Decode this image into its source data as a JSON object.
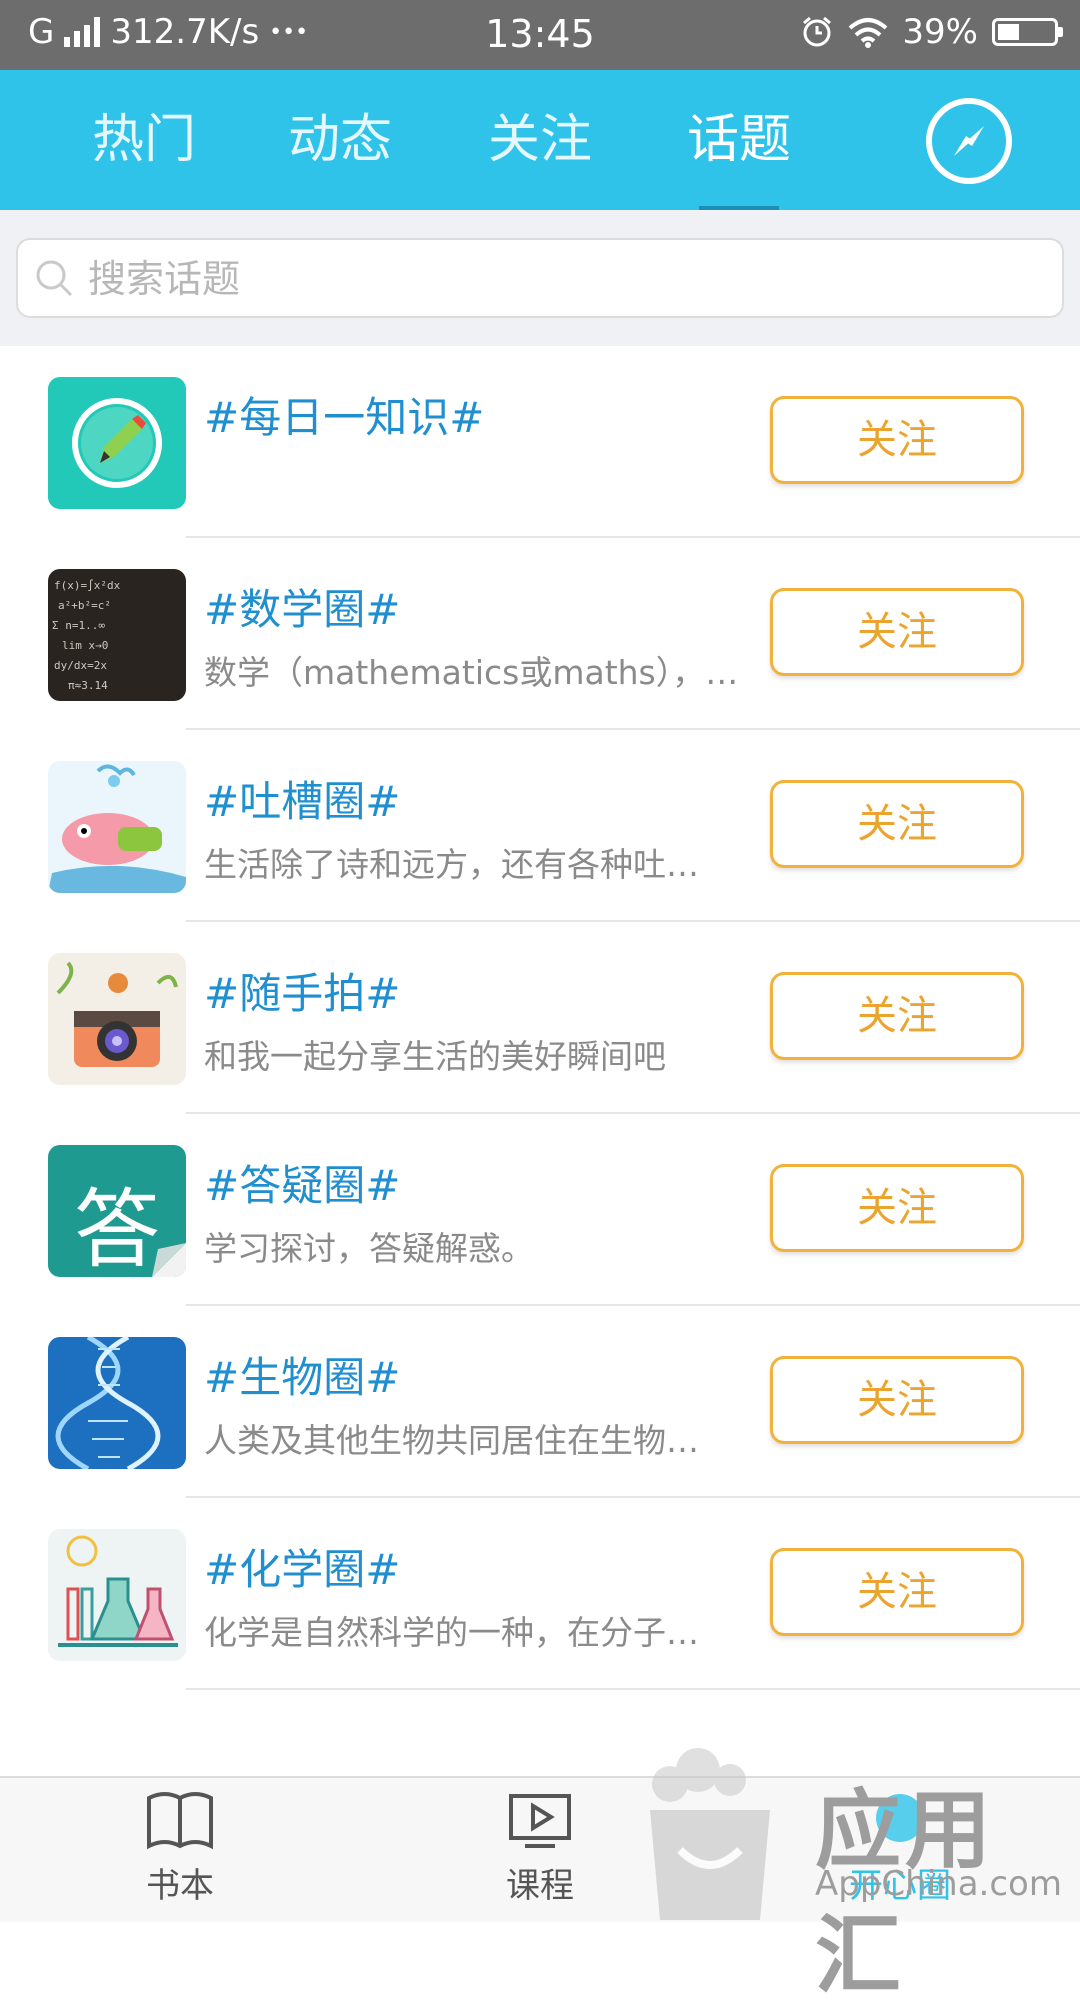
{
  "status_bar": {
    "carrier": "G",
    "speed": "312.7K/s",
    "dots": "•••",
    "time": "13:45",
    "battery_text": "39%",
    "battery_level": 0.39
  },
  "header": {
    "tabs": [
      {
        "label": "热门",
        "active": false
      },
      {
        "label": "动态",
        "active": false
      },
      {
        "label": "关注",
        "active": false
      },
      {
        "label": "话题",
        "active": true
      }
    ],
    "compass_icon": "compass-icon",
    "background": "#2fc3ea"
  },
  "search": {
    "placeholder": "搜索话题",
    "value": ""
  },
  "topics": [
    {
      "title": "#每日一知识#",
      "desc": "",
      "follow": "关注",
      "icon": "pencil-circle-icon"
    },
    {
      "title": "#数学圈#",
      "desc": "数学（mathematics或maths），…",
      "follow": "关注",
      "icon": "chalkboard-icon"
    },
    {
      "title": "#吐槽圈#",
      "desc": "生活除了诗和远方，还有各种吐…",
      "follow": "关注",
      "icon": "patrick-star-icon"
    },
    {
      "title": "#随手拍#",
      "desc": "和我一起分享生活的美好瞬间吧",
      "follow": "关注",
      "icon": "camera-icon"
    },
    {
      "title": "#答疑圈#",
      "desc": "学习探讨，答疑解惑。",
      "follow": "关注",
      "icon": "answer-icon"
    },
    {
      "title": "#生物圈#",
      "desc": "人类及其他生物共同居住在生物…",
      "follow": "关注",
      "icon": "dna-icon"
    },
    {
      "title": "#化学圈#",
      "desc": "化学是自然科学的一种，在分子…",
      "follow": "关注",
      "icon": "lab-flask-icon"
    }
  ],
  "answer_char": "答",
  "bottom_nav": [
    {
      "label": "书本",
      "icon": "book-icon",
      "active": false
    },
    {
      "label": "课程",
      "icon": "play-screen-icon",
      "active": false
    },
    {
      "label": "开心圈",
      "icon": "circle-icon",
      "active": true
    }
  ],
  "watermark": {
    "title": "应用汇",
    "sub": "AppChina.com"
  },
  "colors": {
    "accent": "#2fc3ea",
    "topic_title": "#1f8fd0",
    "follow_border": "#f2b13a"
  }
}
